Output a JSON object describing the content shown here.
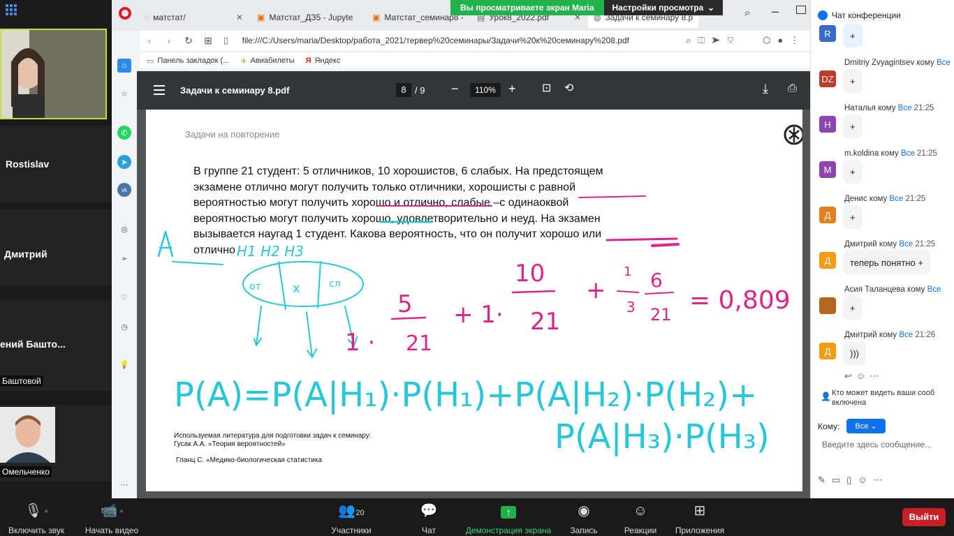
{
  "browser": {
    "tabs": [
      {
        "label": "матстат/"
      },
      {
        "label": "Матстат_ДЗ5 - Jupyte"
      },
      {
        "label": "Матстат_семинар8 - "
      },
      {
        "label": "Урок8_2022.pdf"
      },
      {
        "label": "Задачи к семинару 8.p"
      }
    ],
    "share_banner": {
      "text": "Вы просматриваете экран Maria",
      "settings": "Настройки просмотра"
    },
    "url": "file:///C:/Users/maria/Desktop/работа_2021/тервер%20семинары/Задачи%20к%20семинару%208.pdf",
    "bookmarks": [
      "Панель закладок (...",
      "Авиабилеты",
      "Яндекс"
    ]
  },
  "participants": [
    {
      "name": "Rostislav"
    },
    {
      "name": "Дмитрий"
    },
    {
      "name": "ений  Башто...",
      "sub": "Баштовой"
    },
    {
      "sub": "Омельченко"
    }
  ],
  "pdf": {
    "title": "Задачи к семинару 8.pdf",
    "page": "8",
    "total": "/  9",
    "zoom": "110%",
    "header": "Задачи на повторение",
    "problem_lines": [
      "В группе  21 студент: 5 отличников, 10 хорошистов,  6 слабых. На предстоящем",
      "экзамене отлично могут получить только отличники, хорошисты с равной",
      "вероятностью могут получить хорошо и отлично, слабые –с одинаоквой",
      "вероятностью могут получить хорошо, удовлетворительно и неуд. На  экзамен",
      "вызывается наугад 1 студент. Какова вероятность, что он получит хорошо или",
      "отлично"
    ],
    "literature": [
      "Используемая  литература для подготовки задач к семинару:",
      " Гусак А.А. «Теория  вероятностей»"
    ],
    "literature2": "Гланц С. «Медико-биологическая  статистика"
  },
  "chat": {
    "title": "Чат конференции",
    "messages": [
      {
        "initials": "R",
        "color": "#3a6bc9",
        "sender": "",
        "to": "",
        "time": "",
        "text": "+"
      },
      {
        "initials": "DZ",
        "color": "#c0392b",
        "sender": "Dmitriy Zvyagintsev кому ",
        "to": "Все",
        "time": "",
        "text": "+"
      },
      {
        "initials": "Н",
        "color": "#8e44ad",
        "sender": "Наталья кому ",
        "to": "Все",
        "time": " 21:25",
        "text": "+"
      },
      {
        "initials": "M",
        "color": "#8e44ad",
        "sender": "m.koldina кому ",
        "to": "Все",
        "time": " 21:25",
        "text": "+"
      },
      {
        "initials": "Д",
        "color": "#e67e22",
        "sender": "Денис кому ",
        "to": "Все",
        "time": " 21:25",
        "text": "+"
      },
      {
        "initials": "Д",
        "color": "#f39c12",
        "sender": "Дмитрий кому ",
        "to": "Все",
        "time": " 21:25",
        "text": "теперь понятно +"
      },
      {
        "initials": "",
        "color": "#b5651d",
        "sender": "Асия Таланцева кому ",
        "to": "Все",
        "time": "",
        "text": "+"
      },
      {
        "initials": "Д",
        "color": "#f39c12",
        "sender": "Дмитрий кому ",
        "to": "Все",
        "time": " 21:26",
        "text": ")))"
      }
    ],
    "visibility_note": "Кто может видеть ваши сооб включена",
    "to_label": "Кому:",
    "to_value": "Все",
    "input_placeholder": "Введите здесь сообщение..."
  },
  "toolbar": {
    "audio": "Включить звук",
    "video": "Начать видео",
    "participants": "Участники",
    "participants_count": "20",
    "chat": "Чат",
    "share": "Демонстрация экрана",
    "record": "Запись",
    "reactions": "Реакции",
    "apps": "Приложения",
    "leave": "Выйти"
  }
}
